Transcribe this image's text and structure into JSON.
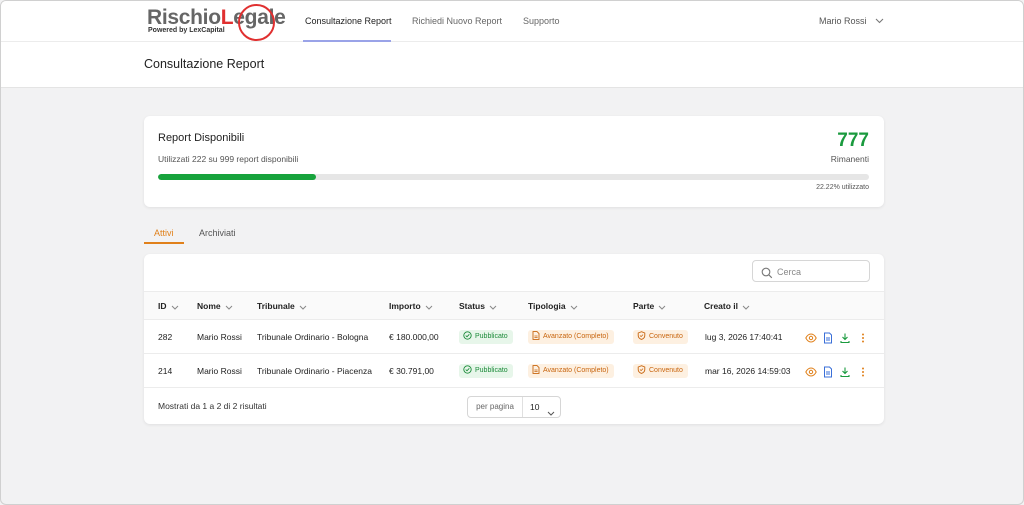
{
  "brand": {
    "logo_main_a": "Rischio",
    "logo_main_b": "L",
    "logo_main_c": "egale",
    "logo_sub": "Powered by LexCapital"
  },
  "nav": {
    "items": [
      "Consultazione Report",
      "Richiedi Nuovo Report",
      "Supporto"
    ],
    "active": "Consultazione Report"
  },
  "user": {
    "name": "Mario Rossi",
    "icon": "chevron-down-icon"
  },
  "page": {
    "title": "Consultazione Report"
  },
  "quota": {
    "title": "Report Disponibili",
    "subtitle": "Utilizzati 222 su 999 report disponibili",
    "remaining": "777",
    "remaining_label": "Rimanenti",
    "used_fraction": 0.2222,
    "used_label": "22.22% utilizzato",
    "bar_color": "#17a33c"
  },
  "tabs": {
    "items": [
      "Attivi",
      "Archiviati"
    ],
    "active": "Attivi"
  },
  "search": {
    "placeholder": "Cerca",
    "value": ""
  },
  "table": {
    "columns": [
      "ID",
      "Nome",
      "Tribunale",
      "Importo",
      "Status",
      "Tipologia",
      "Parte",
      "Creato il"
    ],
    "rows": [
      {
        "id": "282",
        "nome": "Mario Rossi",
        "tribunale": "Tribunale Ordinario - Bologna",
        "importo": "€ 180.000,00",
        "status": "Pubblicato",
        "tipologia": "Avanzato (Completo)",
        "parte": "Convenuto",
        "creato": "lug 3, 2026 17:40:41"
      },
      {
        "id": "214",
        "nome": "Mario Rossi",
        "tribunale": "Tribunale Ordinario - Piacenza",
        "importo": "€ 30.791,00",
        "status": "Pubblicato",
        "tipologia": "Avanzato (Completo)",
        "parte": "Convenuto",
        "creato": "mar 16, 2026 14:59:03"
      }
    ],
    "row_actions": [
      "eye-icon",
      "document-icon",
      "download-icon",
      "more-vertical-icon"
    ]
  },
  "footer": {
    "results": "Mostrati da 1 a 2 di 2 risultati",
    "per_page_label": "per pagina",
    "per_page_value": "10"
  },
  "colors": {
    "accent_orange": "#e0801a",
    "success_green": "#1a9a3e",
    "brand_red": "#e03030",
    "nav_underline": "#9aa3e8"
  }
}
